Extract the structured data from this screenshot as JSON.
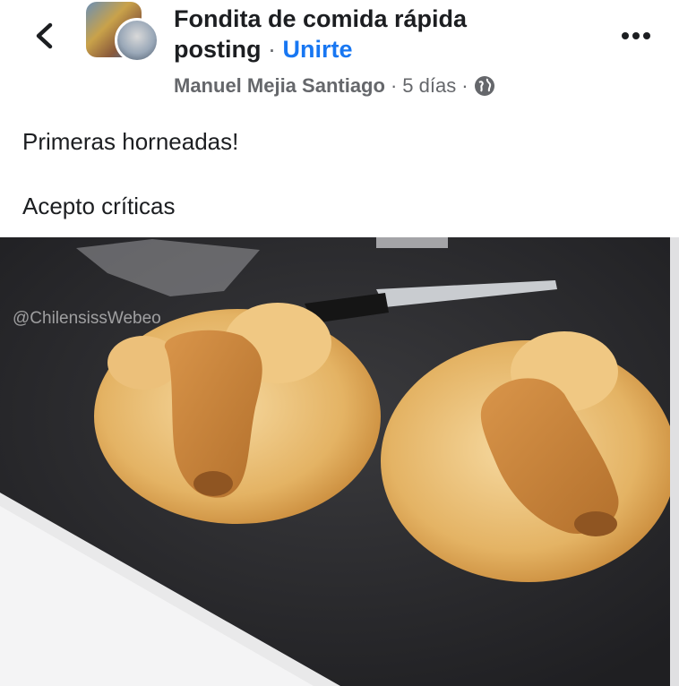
{
  "header": {
    "group_name": "Fondita de comida rápida posting",
    "join_label": "Unirte",
    "author": "Manuel Mejia Santiago",
    "time_ago": "5 días",
    "icons": {
      "back": "chevron-left-icon",
      "privacy": "globe-icon",
      "more": "more-options-icon"
    }
  },
  "post": {
    "lines": [
      "Primeras horneadas!",
      "Acepto críticas"
    ]
  },
  "photo": {
    "watermark": "@ChilensissWebeo",
    "description_colors": {
      "counter": "#2a2a2c",
      "bread": "#e4b364",
      "crust": "#c98a3a"
    }
  },
  "colors": {
    "accent": "#1877f2",
    "text": "#1c1e21",
    "secondary": "#65676b"
  }
}
